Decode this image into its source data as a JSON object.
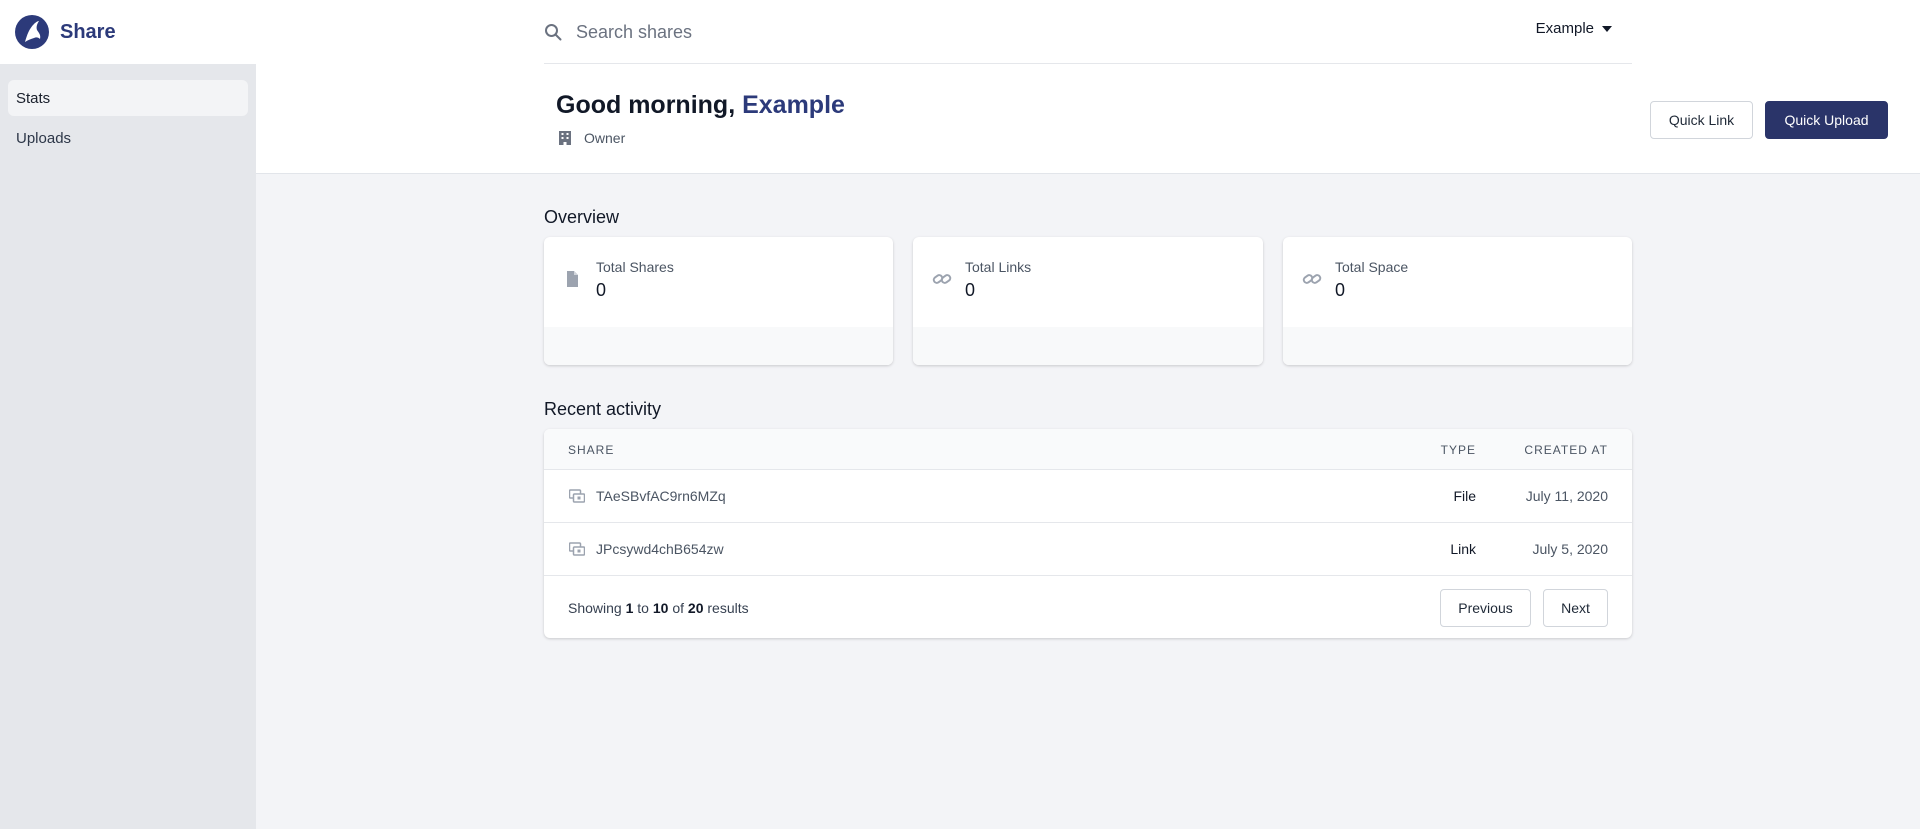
{
  "brand": {
    "name": "Share"
  },
  "sidebar": {
    "items": [
      {
        "label": "Stats",
        "active": true
      },
      {
        "label": "Uploads",
        "active": false
      }
    ]
  },
  "search": {
    "placeholder": "Search shares",
    "value": ""
  },
  "user_menu": {
    "label": "Example"
  },
  "greeting": {
    "prefix": "Good morning,",
    "name": "Example"
  },
  "role": {
    "label": "Owner"
  },
  "actions": {
    "quick_link": "Quick Link",
    "quick_upload": "Quick Upload"
  },
  "overview": {
    "title": "Overview",
    "cards": [
      {
        "label": "Total Shares",
        "value": "0",
        "icon": "document-icon"
      },
      {
        "label": "Total Links",
        "value": "0",
        "icon": "link-icon"
      },
      {
        "label": "Total Space",
        "value": "0",
        "icon": "link-icon"
      }
    ]
  },
  "activity": {
    "title": "Recent activity",
    "columns": {
      "share": "SHARE",
      "type": "TYPE",
      "created_at": "CREATED AT"
    },
    "rows": [
      {
        "share": "TAeSBvfAC9rn6MZq",
        "type": "File",
        "created_at": "July 11, 2020"
      },
      {
        "share": "JPcsywd4chB654zw",
        "type": "Link",
        "created_at": "July 5, 2020"
      }
    ],
    "pagination": {
      "showing": "Showing",
      "from": "1",
      "to_word": "to",
      "to": "10",
      "of_word": "of",
      "total": "20",
      "results": "results",
      "previous": "Previous",
      "next": "Next"
    }
  },
  "colors": {
    "brand": "#2c3a7a",
    "primary_button": "#2a3469",
    "sidebar_bg": "#e5e7eb",
    "page_bg": "#f3f4f7"
  }
}
